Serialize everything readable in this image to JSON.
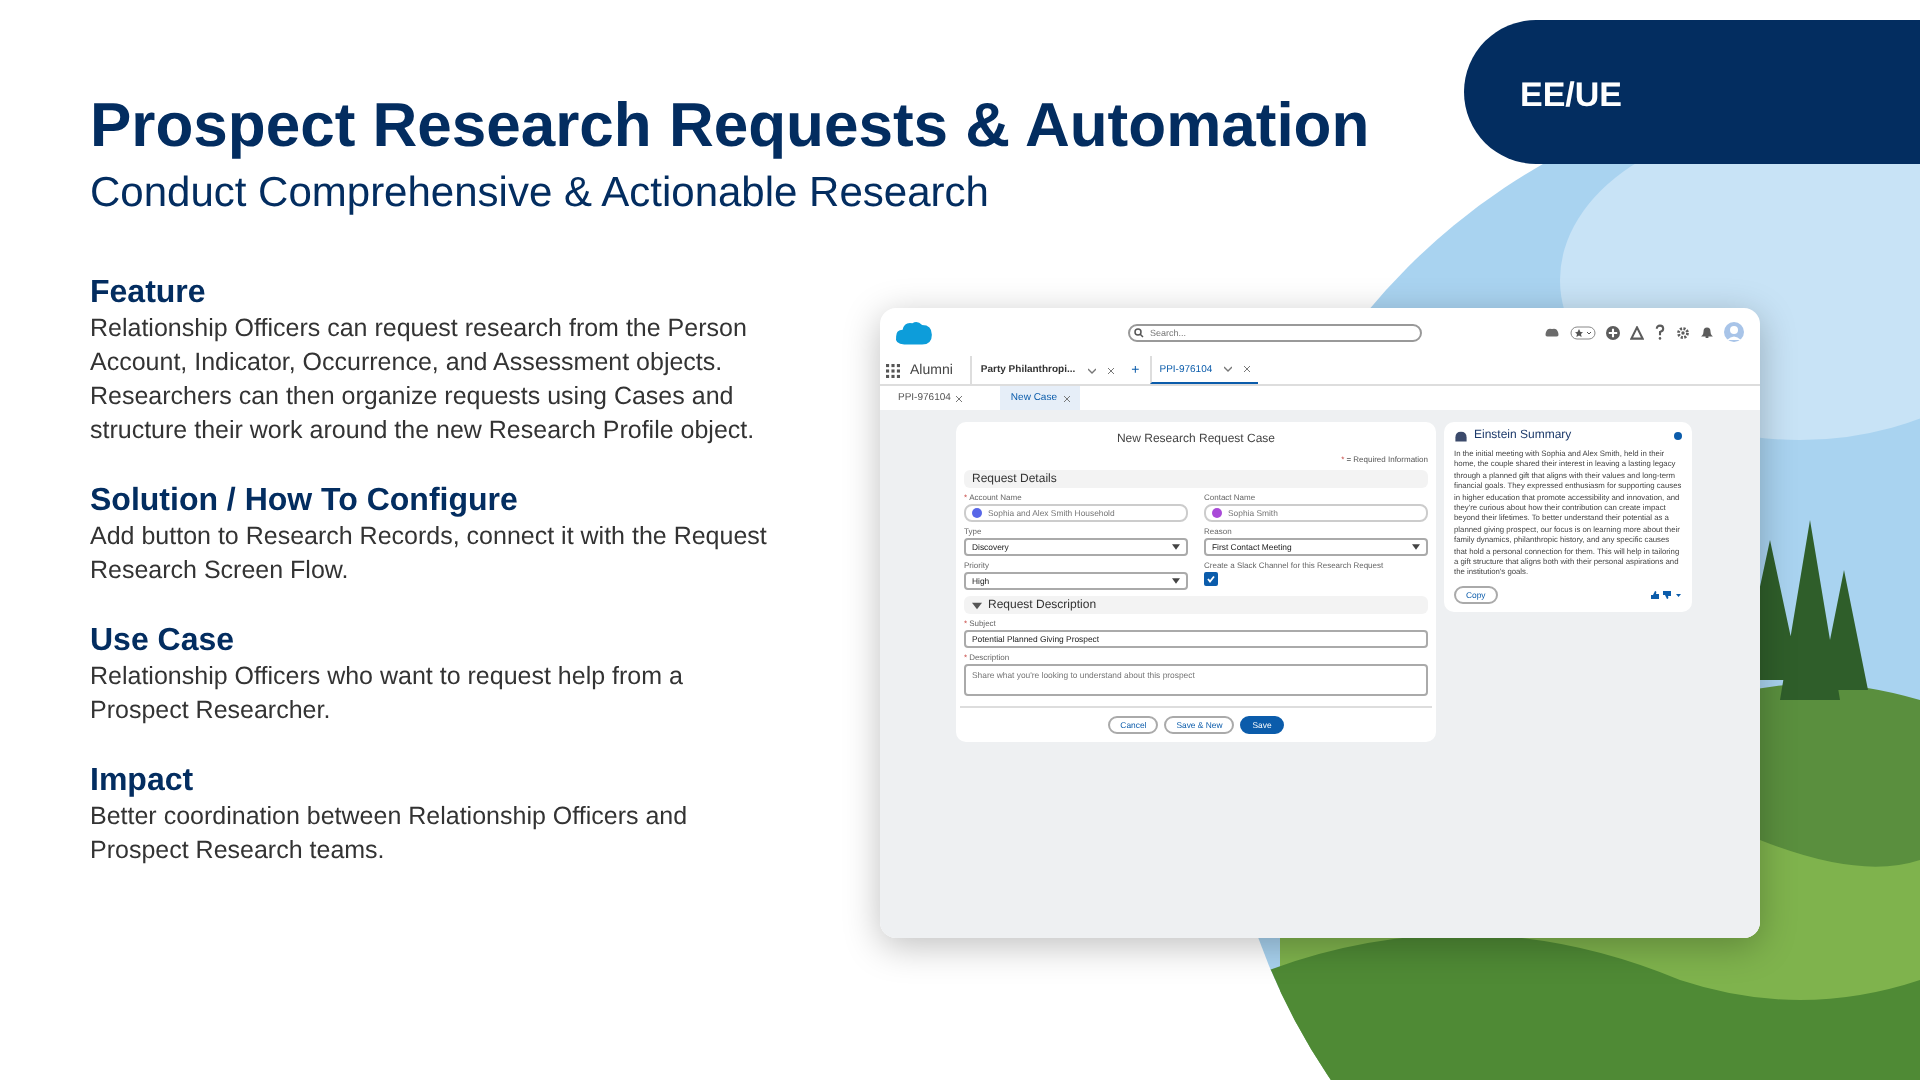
{
  "badge": "EE/UE",
  "title": "Prospect Research Requests & Automation",
  "subtitle": "Conduct Comprehensive & Actionable Research",
  "sections": [
    {
      "heading": "Feature",
      "body": "Relationship Officers can request research from the Person Account, Indicator, Occurrence, and Assessment objects.  Researchers can then organize requests using Cases and structure their work around the new Research Profile object."
    },
    {
      "heading": "Solution / How To Configure",
      "body": "Add button to Research Records, connect it with the Request Research Screen Flow."
    },
    {
      "heading": "Use Case",
      "body": "Relationship Officers who want to request help from a Prospect Researcher."
    },
    {
      "heading": "Impact",
      "body": "Better coordination between Relationship Officers and Prospect Research teams."
    }
  ],
  "app": {
    "search": {
      "placeholder": "Search..."
    },
    "app_name": "Alumni",
    "tabs": [
      {
        "label": "Party Philanthropi...",
        "selected": false
      },
      {
        "label": "PPI-976104",
        "selected": true
      }
    ],
    "add_tab": "+",
    "subtabs": [
      {
        "label": "PPI-976104",
        "selected": false
      },
      {
        "label": "New Case",
        "selected": true
      }
    ],
    "form": {
      "title": "New Research Request Case",
      "required_mark": "*",
      "required_note": "= Required Information",
      "sections": [
        {
          "title": "Request Details",
          "collapsible": false,
          "fields": [
            {
              "kind": "lookup",
              "label": "Account Name",
              "required": true,
              "value": "Sophia and Alex Smith Household",
              "color": "#5867e8"
            },
            {
              "kind": "lookup",
              "label": "Contact Name",
              "required": false,
              "value": "Sophia Smith",
              "color": "#a94ad8"
            },
            {
              "kind": "select",
              "label": "Type",
              "required": false,
              "value": "Discovery"
            },
            {
              "kind": "select",
              "label": "Reason",
              "required": false,
              "value": "First Contact Meeting"
            },
            {
              "kind": "select",
              "label": "Priority",
              "required": false,
              "value": "High"
            },
            {
              "kind": "checkbox",
              "label": "Create a Slack Channel for this Research Request",
              "required": false,
              "checked": true
            }
          ]
        },
        {
          "title": "Request Description",
          "collapsible": true,
          "fields": [
            {
              "kind": "text",
              "label": "Subject",
              "required": true,
              "value": "Potential Planned Giving Prospect"
            },
            {
              "kind": "textarea",
              "label": "Description",
              "required": true,
              "placeholder": "Share what you're looking to understand about this prospect"
            }
          ]
        }
      ],
      "buttons": [
        {
          "label": "Cancel",
          "kind": "neutral"
        },
        {
          "label": "Save & New",
          "kind": "neutral"
        },
        {
          "label": "Save",
          "kind": "brand"
        }
      ]
    },
    "einstein": {
      "title": "Einstein Summary",
      "body": "In the initial meeting with Sophia and Alex Smith, held in their home, the couple shared their interest in leaving a lasting legacy through a planned gift that aligns with their values and long-term financial goals. They expressed enthusiasm for supporting causes in higher education that promote accessibility and innovation, and they're curious about how their contribution can create impact beyond their lifetimes. To better understand their potential as a planned giving prospect, our focus is on learning more about their family dynamics, philanthropic history, and any specific causes that hold a personal connection for them. This will help in tailoring a gift structure that aligns both with their personal aspirations and the institution's goals.",
      "copy_button": "Copy"
    }
  }
}
